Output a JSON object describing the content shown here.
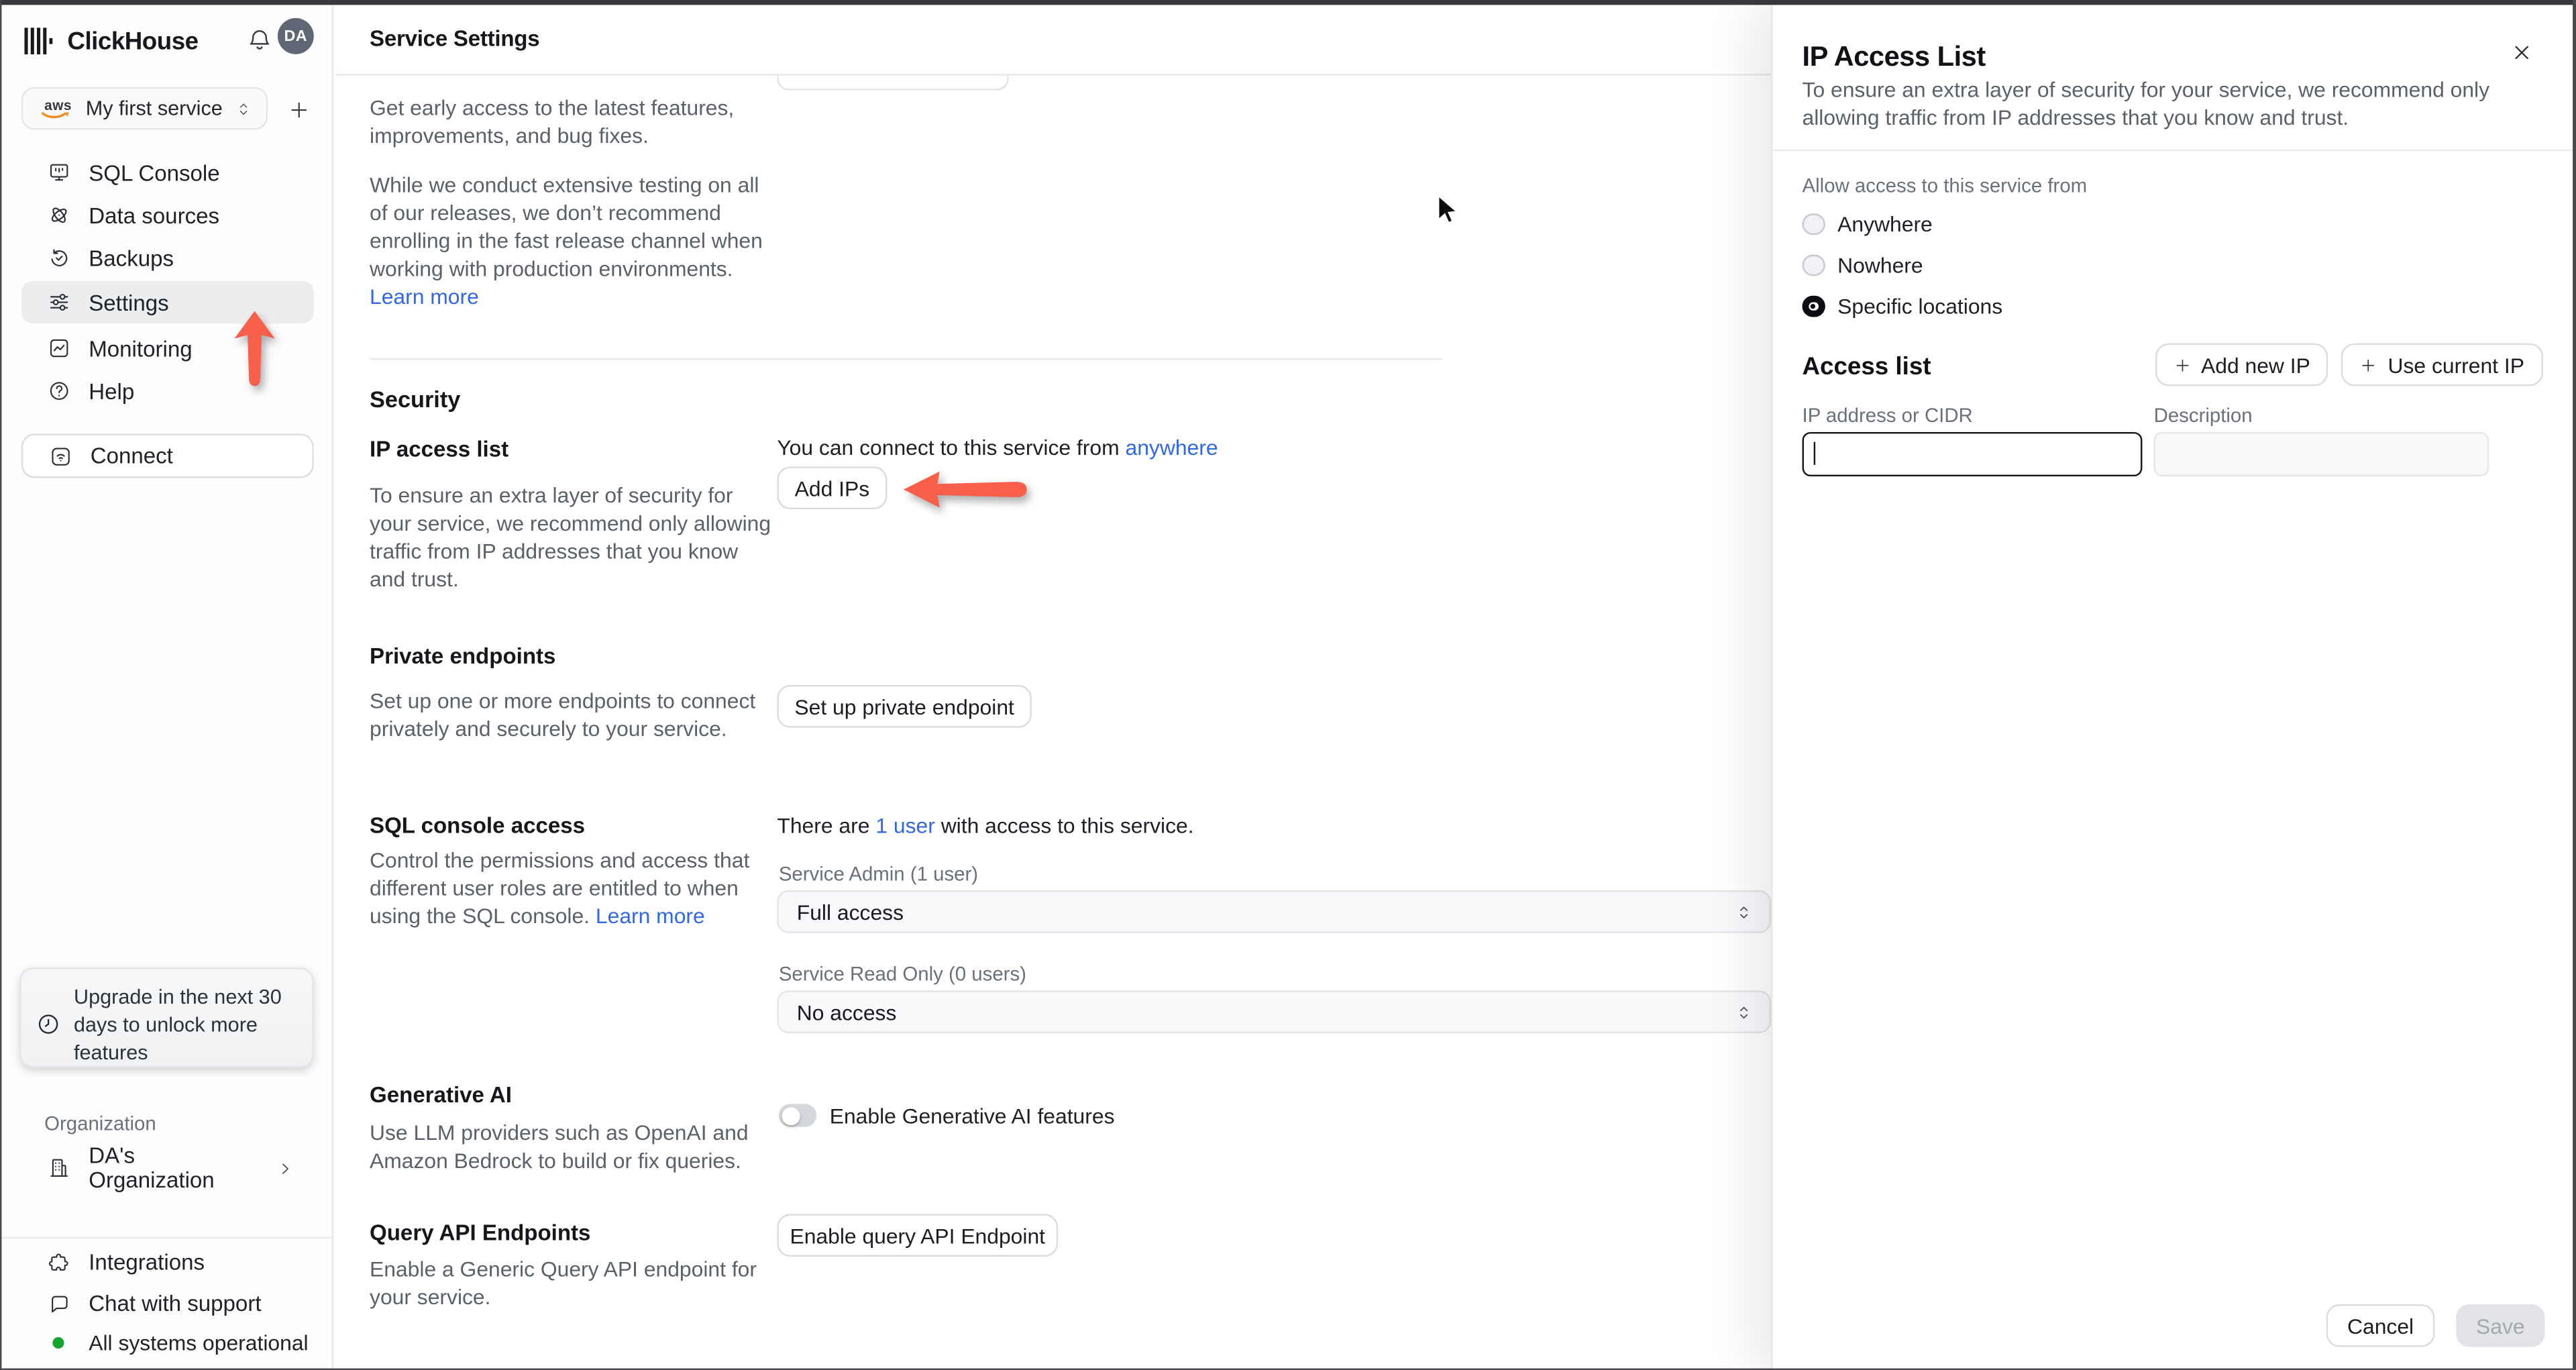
{
  "accent": {
    "link_blue": "#3068e8",
    "arrow_red": "#f8604c",
    "status_green": "#18a52e",
    "avatar_bg": "#5f6774"
  },
  "sidebar": {
    "brand": "ClickHouse",
    "avatar_initials": "DA",
    "service_selector": {
      "label": "My first service",
      "provider": "aws"
    },
    "nav": [
      {
        "label": "SQL Console"
      },
      {
        "label": "Data sources"
      },
      {
        "label": "Backups"
      },
      {
        "label": "Settings"
      },
      {
        "label": "Monitoring"
      },
      {
        "label": "Help"
      }
    ],
    "connect_label": "Connect",
    "upgrade_notice": "Upgrade in the next 30 days to unlock more features",
    "organization_section_label": "Organization",
    "organization_name": "DA's Organization",
    "integrations_label": "Integrations",
    "chat_label": "Chat with support",
    "status_label": "All systems operational"
  },
  "main": {
    "title": "Service Settings",
    "fast_release": {
      "paragraph1": "Get early access to the latest features, improvements, and bug fixes.",
      "paragraph2": "While we conduct extensive testing on all of our releases, we don’t recommend enrolling in the fast release channel when working with production environments.",
      "learn_more": "Learn more"
    },
    "security": {
      "section_title": "Security",
      "ip_access_list": {
        "title": "IP access list",
        "description": "To ensure an extra layer of security for your service, we recommend only allowing traffic from IP addresses that you know and trust.",
        "connect_prefix": "You can connect to this service from",
        "connect_link": "anywhere",
        "add_ips_button": "Add IPs"
      },
      "private_endpoints": {
        "title": "Private endpoints",
        "description": "Set up one or more endpoints to connect privately and securely to your service.",
        "setup_button": "Set up private endpoint"
      },
      "sql_console_access": {
        "title": "SQL console access",
        "users_prefix": "There are",
        "users_link": "1 user",
        "users_suffix": "with access to this service.",
        "description": "Control the permissions and access that different user roles are entitled to when using the SQL console.",
        "learn_more": "Learn more",
        "service_admin_label": "Service Admin (1 user)",
        "service_admin_value": "Full access",
        "service_read_only_label": "Service Read Only (0 users)",
        "service_read_only_value": "No access"
      },
      "generative_ai": {
        "title": "Generative AI",
        "toggle_label": "Enable Generative AI features",
        "toggle_state": "off",
        "description": "Use LLM providers such as OpenAI and Amazon Bedrock to build or fix queries."
      },
      "query_api_endpoints": {
        "title": "Query API Endpoints",
        "enable_button": "Enable query API Endpoint",
        "description": "Enable a Generic Query API endpoint for your service."
      }
    }
  },
  "panel": {
    "title": "IP Access List",
    "description": "To ensure an extra layer of security for your service, we recommend only allowing traffic from IP addresses that you know and trust.",
    "allow_access_label": "Allow access to this service from",
    "options": [
      {
        "label": "Anywhere",
        "selected": false
      },
      {
        "label": "Nowhere",
        "selected": false
      },
      {
        "label": "Specific locations",
        "selected": true
      }
    ],
    "access_list": {
      "title": "Access list",
      "add_new_ip_button": "Add new IP",
      "use_current_ip_button": "Use current IP",
      "ip_column_label": "IP address or CIDR",
      "description_column_label": "Description",
      "ip_input_value": "",
      "description_input_value": ""
    },
    "footer": {
      "cancel_button": "Cancel",
      "save_button": "Save"
    }
  }
}
